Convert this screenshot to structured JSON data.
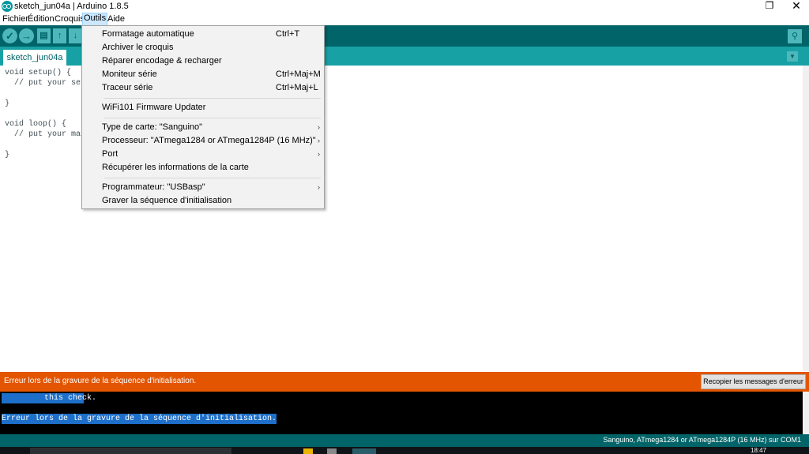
{
  "window": {
    "title": "sketch_jun04a | Arduino 1.8.5",
    "restore_glyph": "❐",
    "close_glyph": "✕"
  },
  "menubar": {
    "items": [
      "Fichier",
      "Édition",
      "Croquis",
      "Outils",
      "Aide"
    ],
    "active": "Outils"
  },
  "toolbar": {
    "verify_glyph": "✓",
    "upload_glyph": "→",
    "new_glyph": "▤",
    "open_glyph": "↑",
    "save_glyph": "↓",
    "serial_glyph": "⚲"
  },
  "tabs": {
    "sketch_name": "sketch_jun04a",
    "menu_glyph": "▼"
  },
  "editor": {
    "lines": [
      "void setup() {",
      "  // put your setup",
      "",
      "}",
      "",
      "void loop() {",
      "  // put your main",
      "",
      "}"
    ]
  },
  "dropdown": {
    "items": [
      {
        "label": "Formatage automatique",
        "shortcut": "Ctrl+T"
      },
      {
        "label": "Archiver le croquis",
        "shortcut": ""
      },
      {
        "label": "Réparer encodage & recharger",
        "shortcut": ""
      },
      {
        "label": "Moniteur série",
        "shortcut": "Ctrl+Maj+M"
      },
      {
        "label": "Traceur série",
        "shortcut": "Ctrl+Maj+L"
      },
      {
        "label": "WiFi101 Firmware Updater",
        "shortcut": ""
      },
      {
        "label": "Type de carte: \"Sanguino\"",
        "shortcut": "",
        "submenu": true
      },
      {
        "label": "Processeur: \"ATmega1284 or ATmega1284P (16 MHz)\"",
        "shortcut": "",
        "submenu": true
      },
      {
        "label": "Port",
        "shortcut": "",
        "submenu": true
      },
      {
        "label": "Récupérer les informations de la carte",
        "shortcut": ""
      },
      {
        "label": "Programmateur: \"USBasp\"",
        "shortcut": "",
        "submenu": true
      },
      {
        "label": "Graver la séquence d'initialisation",
        "shortcut": ""
      }
    ],
    "arrow_glyph": "›"
  },
  "status": {
    "error_message": "Erreur lors de la gravure de la séquence d'initialisation.",
    "copy_errors_label": "Recopier les messages d'erreur",
    "board_info": "Sanguino, ATmega1284 or ATmega1284P (16 MHz) sur COM1"
  },
  "console": {
    "lines": [
      "         this check.",
      "Erreur lors de la gravure de la séquence d'initialisation."
    ]
  },
  "taskbar": {
    "clock": "18:47"
  },
  "colors": {
    "toolbar": "#006468",
    "tabbar": "#17a1a5",
    "error_bar": "#e35500",
    "console_bg": "#000000",
    "selection": "#1e6fc9"
  }
}
